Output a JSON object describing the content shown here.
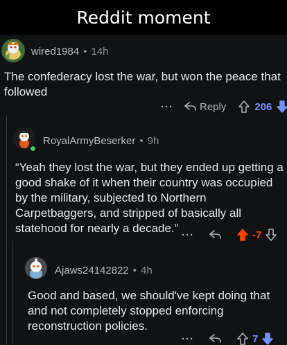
{
  "title": "Reddit moment",
  "comments": [
    {
      "user": "wired1984",
      "dot": "•",
      "age": "14h",
      "text": "The confederacy lost the war, but won the peace that followed",
      "more": "···",
      "reply_label": "Reply",
      "score": "206",
      "vote_state": "downvoted",
      "score_color": "#7193ff"
    },
    {
      "user": "RoyalArmyBeserker",
      "dot": "•",
      "age": "9h",
      "text": "“Yeah they lost the war, but they ended up getting a good shake of it when their country was occupied by the military, subjected to Northern Carpetbaggers, and stripped of basically all statehood for nearly a decade.”",
      "more": "···",
      "score": "-7",
      "vote_state": "upvoted",
      "score_color": "#ff4500"
    },
    {
      "user": "Ajaws24142822",
      "dot": "•",
      "age": "4h",
      "text": "Good and based, we should've kept doing that and not completely stopped enforcing reconstruction policies.",
      "more": "···",
      "score": "7",
      "vote_state": "downvoted",
      "score_color": "#7193ff"
    }
  ],
  "colors": {
    "background": "#111213",
    "upvote": "#ff4500",
    "downvote": "#7193ff",
    "text": "#e6e7e8",
    "muted": "#8e9093"
  }
}
